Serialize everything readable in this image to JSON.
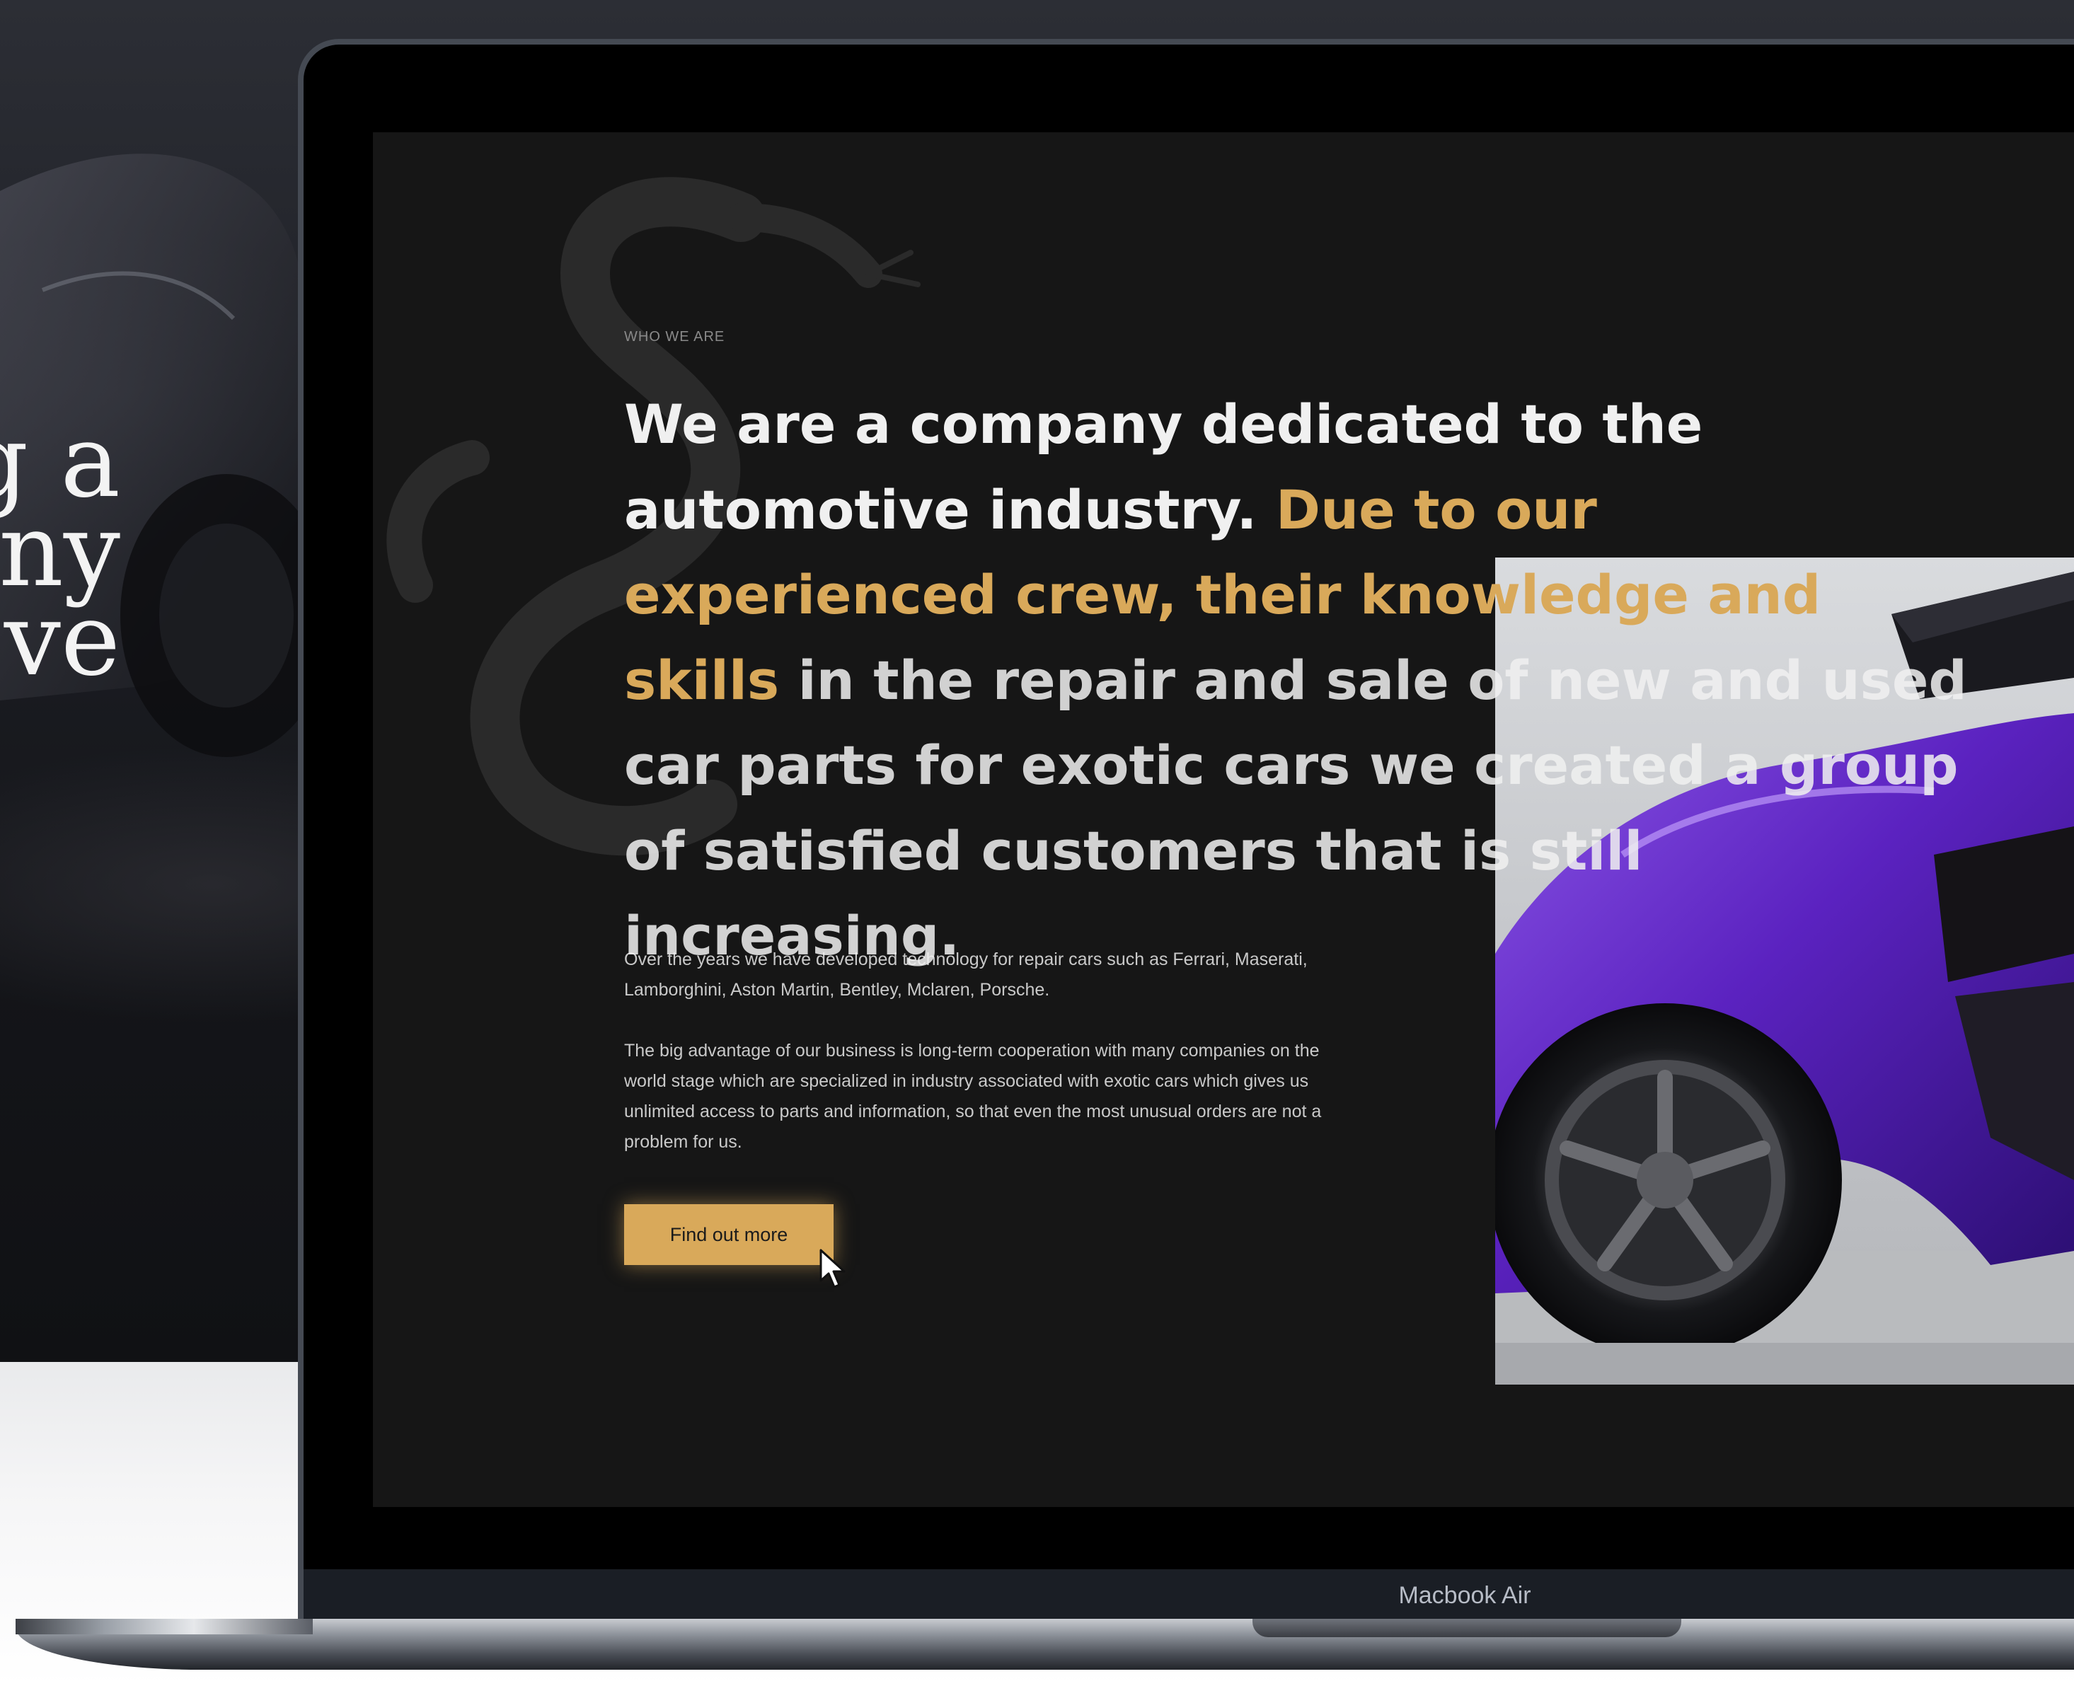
{
  "background": {
    "hero_lines": [
      "g a",
      "ny",
      "ve"
    ]
  },
  "device": {
    "label": "Macbook Air"
  },
  "section": {
    "eyebrow": "WHO WE ARE",
    "headline_part1": "We are a company dedicated to the automotive industry. ",
    "headline_highlight": "Due to our experienced crew, their knowledge and skills",
    "headline_part2": " in the repair and sale of new and used car parts for exotic cars we created a group of satisfied customers that is still increasing.",
    "paragraph1": "Over the years we have developed technology for repair cars such as Ferrari, Maserati, Lamborghini, Aston Martin, Bentley, Mclaren, Porsche.",
    "paragraph2": "The big advantage of our business is long-term cooperation with many companies on the world stage which are specialized in industry associated with exotic cars which gives us unlimited access to parts and information, so that even the most unusual orders are not a problem for us.",
    "cta_label": "Find out more"
  },
  "colors": {
    "accent": "#d9a95a",
    "screen_background": "#161616",
    "headline": "#f0f0f0",
    "car": "#6a2fc4"
  },
  "icons": {
    "cursor": "mouse-pointer-icon",
    "watermark": "snake-logo-icon"
  }
}
